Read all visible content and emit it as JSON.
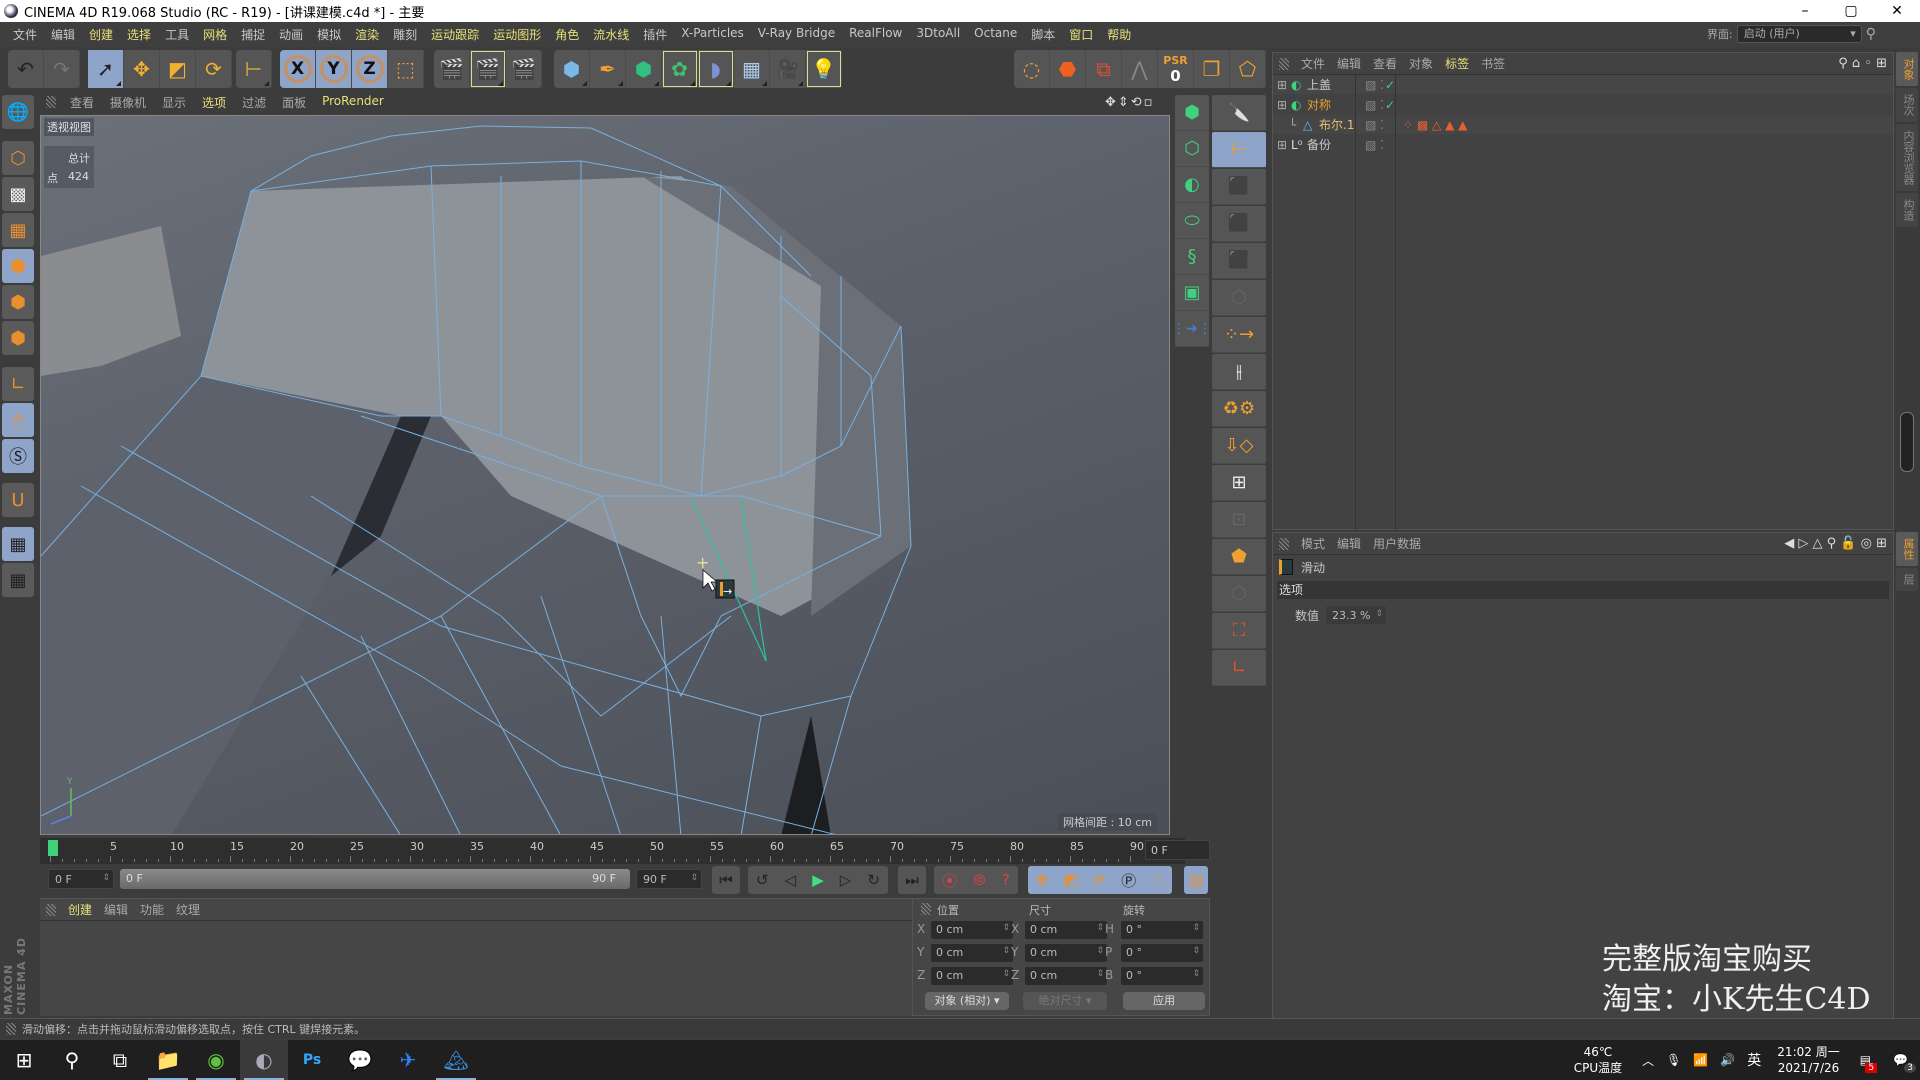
{
  "window": {
    "title": "CINEMA 4D R19.068 Studio (RC - R19) - [讲课建模.c4d *] - 主要",
    "minimize": "–",
    "restore": "▢",
    "close": "✕"
  },
  "menubar": {
    "items": [
      {
        "label": "文件",
        "hl": false
      },
      {
        "label": "编辑",
        "hl": false
      },
      {
        "label": "创建",
        "hl": true
      },
      {
        "label": "选择",
        "hl": true
      },
      {
        "label": "工具",
        "hl": false
      },
      {
        "label": "网格",
        "hl": true
      },
      {
        "label": "捕捉",
        "hl": false
      },
      {
        "label": "动画",
        "hl": false
      },
      {
        "label": "模拟",
        "hl": false
      },
      {
        "label": "渲染",
        "hl": true
      },
      {
        "label": "雕刻",
        "hl": false
      },
      {
        "label": "运动跟踪",
        "hl": true
      },
      {
        "label": "运动图形",
        "hl": true
      },
      {
        "label": "角色",
        "hl": true
      },
      {
        "label": "流水线",
        "hl": true
      },
      {
        "label": "插件",
        "hl": false
      },
      {
        "label": "X-Particles",
        "hl": false
      },
      {
        "label": "V-Ray Bridge",
        "hl": false
      },
      {
        "label": "RealFlow",
        "hl": false
      },
      {
        "label": "3DtoAll",
        "hl": false
      },
      {
        "label": "Octane",
        "hl": false
      },
      {
        "label": "脚本",
        "hl": false
      },
      {
        "label": "窗口",
        "hl": true
      },
      {
        "label": "帮助",
        "hl": true
      }
    ],
    "interface_label": "界面:",
    "interface_value": "启动 (用户)"
  },
  "toolbar": {
    "psr_label": "PSR",
    "psr_value": "0",
    "x": "X",
    "y": "Y",
    "z": "Z"
  },
  "viewport_menu": {
    "items": [
      {
        "label": "查看",
        "hl": false
      },
      {
        "label": "摄像机",
        "hl": false
      },
      {
        "label": "显示",
        "hl": false
      },
      {
        "label": "选项",
        "hl": true
      },
      {
        "label": "过滤",
        "hl": false
      },
      {
        "label": "面板",
        "hl": false
      },
      {
        "label": "ProRender",
        "hl": true
      }
    ]
  },
  "viewport": {
    "name": "透视视图",
    "stats_header": "总计",
    "stats_label": "点",
    "stats_value": "424",
    "grid_spacing": "网格间距 : 10 cm",
    "axis_y": "Y"
  },
  "timeline": {
    "ticks": [
      "0",
      "5",
      "10",
      "15",
      "20",
      "25",
      "30",
      "35",
      "40",
      "45",
      "50",
      "55",
      "60",
      "65",
      "70",
      "75",
      "80",
      "85",
      "90"
    ],
    "current_frame": "0 F",
    "start": "0 F",
    "range_start": "0 F",
    "range_end": "90 F",
    "end": "90 F"
  },
  "material_panel": {
    "tabs": [
      {
        "label": "创建",
        "hl": true
      },
      {
        "label": "编辑",
        "hl": false
      },
      {
        "label": "功能",
        "hl": false
      },
      {
        "label": "纹理",
        "hl": false
      }
    ]
  },
  "brand": "MAXON CINEMA 4D",
  "coords": {
    "pos_header": "位置",
    "size_header": "尺寸",
    "rot_header": "旋转",
    "rows": [
      {
        "l1": "X",
        "v1": "0 cm",
        "l2": "X",
        "v2": "0 cm",
        "l3": "H",
        "v3": "0 °"
      },
      {
        "l1": "Y",
        "v1": "0 cm",
        "l2": "Y",
        "v2": "0 cm",
        "l3": "P",
        "v3": "0 °"
      },
      {
        "l1": "Z",
        "v1": "0 cm",
        "l2": "Z",
        "v2": "0 cm",
        "l3": "B",
        "v3": "0 °"
      }
    ],
    "mode": "对象 (相对)",
    "size_mode": "绝对尺寸",
    "apply": "应用"
  },
  "object_manager": {
    "menu": [
      "文件",
      "编辑",
      "查看",
      "对象",
      "标签",
      "书签"
    ],
    "menu_hl": 4,
    "objects": [
      {
        "name": "上盖",
        "color": "#c8c8c8",
        "check": "✓"
      },
      {
        "name": "对称",
        "color": "#e8a030",
        "check": "✓"
      },
      {
        "name": "布尔.1",
        "color": "#e8c070",
        "check": ""
      },
      {
        "name": "备份",
        "color": "#c8c8c8",
        "check": ""
      }
    ]
  },
  "attribute_manager": {
    "menu": [
      "模式",
      "编辑",
      "用户数据"
    ],
    "tool_name": "滑动",
    "section": "选项",
    "param_label": "数值",
    "param_value": "23.3 %"
  },
  "side_tabs": {
    "top": [
      {
        "label": "对象",
        "active": true
      },
      {
        "label": "场次",
        "active": false
      },
      {
        "label": "内容浏览器",
        "active": false
      },
      {
        "label": "构造",
        "active": false
      }
    ],
    "bottom": [
      {
        "label": "属性",
        "active": true
      },
      {
        "label": "层",
        "active": false
      }
    ]
  },
  "watermark": {
    "line1": "完整版淘宝购买",
    "line2": "淘宝：小K先生C4D"
  },
  "status": "滑动偏移：点击并拖动鼠标滑动偏移选取点，按住 CTRL 键焊接元素。",
  "taskbar": {
    "cpu_temp": "46℃",
    "cpu_label": "CPU温度",
    "ime": "英",
    "time": "21:02 周一",
    "date": "2021/7/26",
    "notif_badge": "5",
    "action_badge": "3"
  }
}
